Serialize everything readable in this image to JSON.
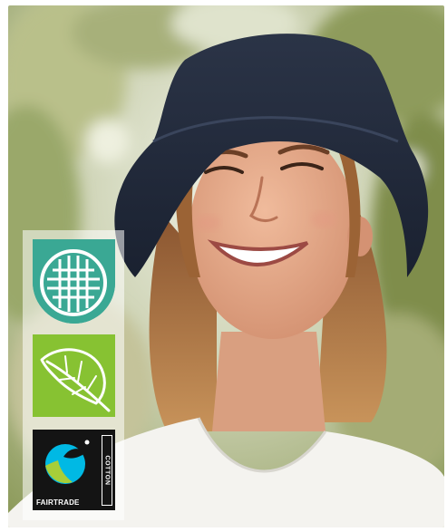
{
  "scene": {
    "palette": {
      "background_light": "#e8eadc",
      "foliage_green": "#9aa86a",
      "hat_navy": "#232b3b",
      "skin": "#e2a88a",
      "hair": "#a86b3c",
      "shirt": "#f4f3ef"
    }
  },
  "badges": [
    {
      "icon": "woven-fabric-icon",
      "color": "#3aa894"
    },
    {
      "icon": "leaf-icon",
      "color": "#87c232"
    },
    {
      "icon": "fairtrade-logo",
      "color": "#141414",
      "label": "FAIRTRADE",
      "side_label": "COTTON"
    }
  ]
}
